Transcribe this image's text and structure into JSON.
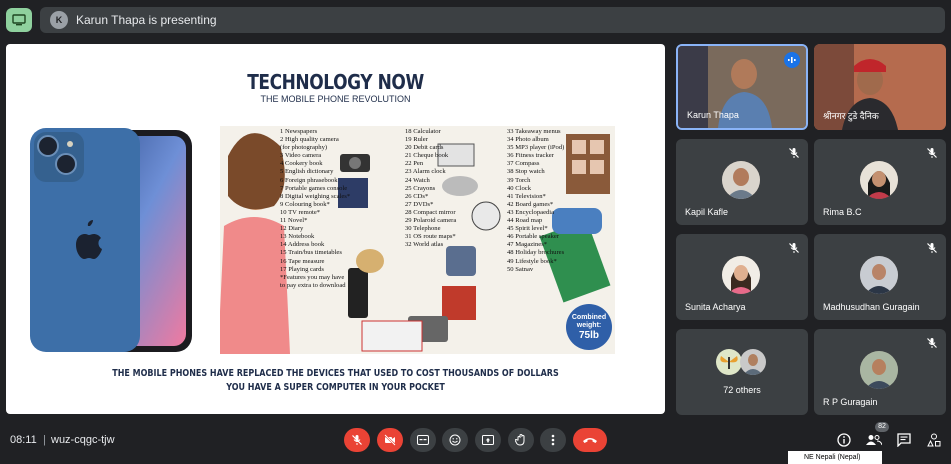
{
  "header": {
    "presenter_text": "Karun Thapa is presenting",
    "presenter_initial": "K"
  },
  "slide": {
    "title": "TECHNOLOGY NOW",
    "subtitle": "THE MOBILE PHONE REVOLUTION",
    "col1": [
      "1 Newspapers",
      "2 High quality camera",
      "(for photography)",
      "3 Video camera",
      "4 Cookery book",
      "5 English dictionary",
      "6 Foreign phrasebook",
      "7 Portable games console",
      "8 Digital weighing scales*",
      "9 Colouring book*",
      "10 TV remote*",
      "11 Novel*",
      "12 Diary",
      "13 Notebook",
      "14 Address book",
      "15 Train/bus timetables",
      "16 Tape measure",
      "17 Playing cards",
      "*Features you may have",
      "to pay extra to download"
    ],
    "col2": [
      "18 Calculator",
      "19 Ruler",
      "20 Debit cards",
      "21 Cheque book",
      "22 Pen",
      "23 Alarm clock",
      "24 Watch",
      "25 Crayons",
      "26 CDs*",
      "27 DVDs*",
      "28 Compact mirror",
      "29 Polaroid camera",
      "30 Telephone",
      "31 OS route maps*",
      "32 World atlas"
    ],
    "col3": [
      "33 Takeaway menus",
      "34 Photo album",
      "35 MP3 player (iPod)",
      "36 Fitness tracker",
      "37 Compass",
      "38 Stop watch",
      "39 Torch",
      "40 Clock",
      "41 Television*",
      "42 Board games*",
      "43 Encyclopaedia",
      "44 Road map",
      "45 Spirit level*",
      "46 Portable speaker",
      "47 Magazines*",
      "48 Holiday brochures",
      "49 Lifestyle book*",
      "50 Satnav"
    ],
    "combined": [
      "Combined",
      "weight:",
      "75lb"
    ],
    "footer1": "THE MOBILE PHONES HAVE REPLACED THE DEVICES THAT USED TO COST THOUSANDS OF DOLLARS",
    "footer2": "YOU HAVE A SUPER COMPUTER IN YOUR POCKET"
  },
  "participants": [
    {
      "name": "Karun Thapa",
      "state": "speaking"
    },
    {
      "name": "श्रीनगर टुडे दैनिक",
      "state": "video"
    },
    {
      "name": "Kapil Kafle",
      "state": "muted"
    },
    {
      "name": "Rima B.C",
      "state": "muted"
    },
    {
      "name": "Sunita Acharya",
      "state": "muted"
    },
    {
      "name": "Madhusudhan Guragain",
      "state": "muted"
    },
    {
      "name": "72 others",
      "state": "group"
    },
    {
      "name": "R P Guragain",
      "state": "muted"
    }
  ],
  "footer": {
    "time": "08:11",
    "separator": "|",
    "meeting_code": "wuz-cqgc-tjw",
    "people_count": "82",
    "language": "NE Nepali (Nepal)"
  },
  "colors": {
    "accent": "#8ab4f8",
    "danger": "#ea4335",
    "present": "#8fd19e",
    "bg": "#202124",
    "tile": "#3c4043"
  }
}
